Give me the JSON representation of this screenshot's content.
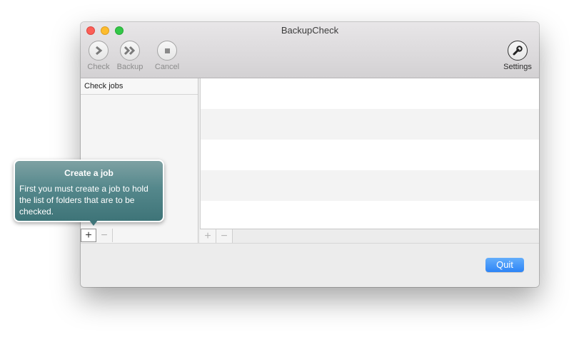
{
  "window": {
    "title": "BackupCheck"
  },
  "toolbar": {
    "check_label": "Check",
    "backup_label": "Backup",
    "cancel_label": "Cancel",
    "settings_label": "Settings"
  },
  "left_pane": {
    "header": "Check jobs"
  },
  "buttons": {
    "add": "+",
    "remove": "−",
    "quit": "Quit"
  },
  "popover": {
    "title": "Create a job",
    "body": "First you must create a job to hold the list of folders that are to be checked."
  },
  "colors": {
    "accent": "#2d84f6",
    "popover": "#4e8488"
  }
}
